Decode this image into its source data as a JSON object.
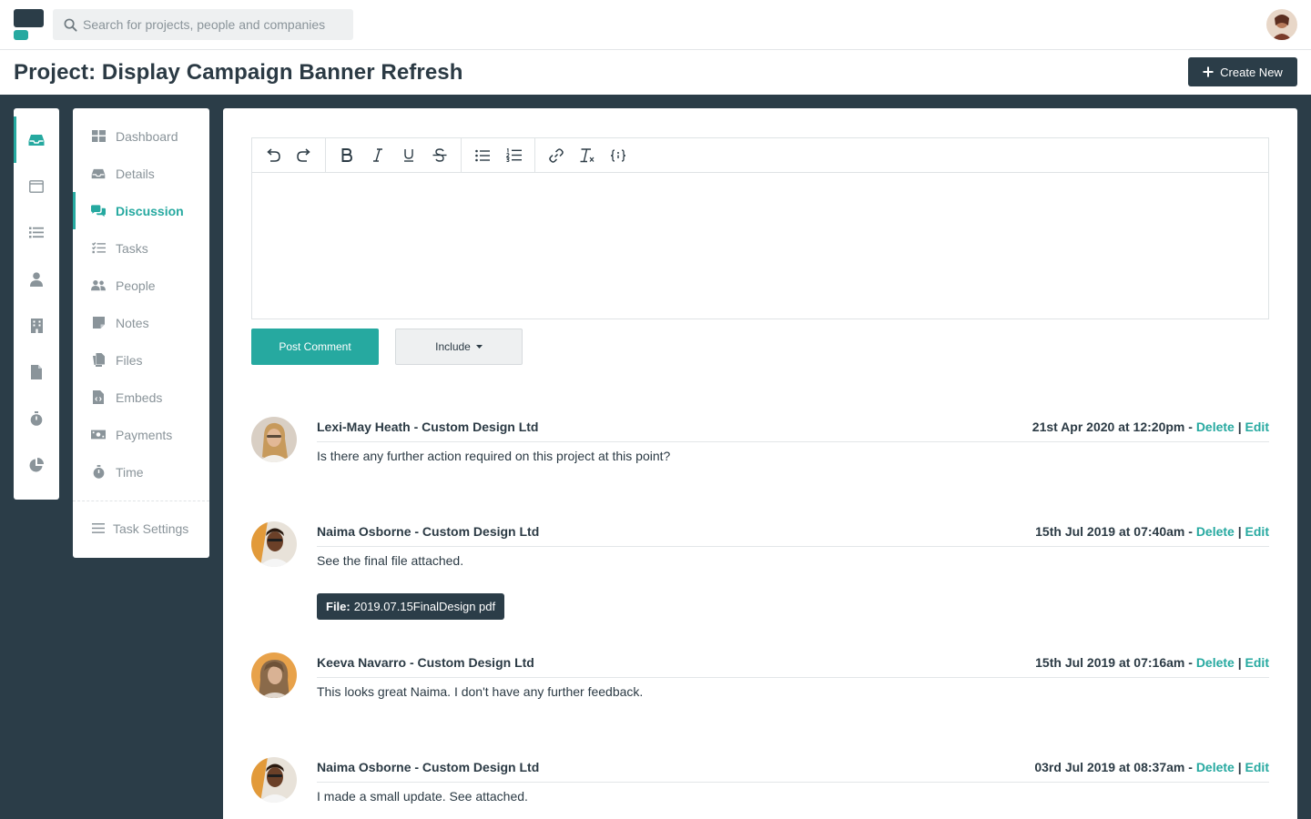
{
  "search": {
    "placeholder": "Search for projects, people and companies"
  },
  "header": {
    "title": "Project: Display Campaign Banner Refresh",
    "create_label": "Create New"
  },
  "rail": {
    "items": [
      "inbox-icon",
      "window-icon",
      "list-icon",
      "user-icon",
      "building-icon",
      "file-icon",
      "stopwatch-icon",
      "pie-chart-icon"
    ],
    "active": 0
  },
  "subnav": {
    "items": [
      {
        "label": "Dashboard",
        "icon": "grid-icon"
      },
      {
        "label": "Details",
        "icon": "inbox-icon"
      },
      {
        "label": "Discussion",
        "icon": "comments-icon",
        "active": true
      },
      {
        "label": "Tasks",
        "icon": "tasks-icon"
      },
      {
        "label": "People",
        "icon": "users-icon"
      },
      {
        "label": "Notes",
        "icon": "note-icon"
      },
      {
        "label": "Files",
        "icon": "files-icon"
      },
      {
        "label": "Embeds",
        "icon": "embed-file-icon"
      },
      {
        "label": "Payments",
        "icon": "money-icon"
      },
      {
        "label": "Time",
        "icon": "stopwatch-icon"
      }
    ],
    "settings_label": "Task Settings"
  },
  "editor": {
    "toolbar": [
      "undo-icon",
      "redo-icon",
      "bold-icon",
      "italic-icon",
      "underline-icon",
      "strikethrough-icon",
      "bullet-list-icon",
      "numbered-list-icon",
      "link-icon",
      "clear-format-icon",
      "code-icon"
    ],
    "post_label": "Post Comment",
    "include_label": "Include"
  },
  "comments": [
    {
      "author": "Lexi-May Heath - Custom Design Ltd",
      "date": "21st Apr 2020 at 12:20pm",
      "text": "Is there any further action required on this project at this point?",
      "delete_label": "Delete",
      "edit_label": "Edit"
    },
    {
      "author": "Naima Osborne - Custom Design Ltd",
      "date": "15th Jul 2019 at 07:40am",
      "text": "See the final file attached.",
      "file_prefix": "File:",
      "file_name": "2019.07.15FinalDesign pdf",
      "delete_label": "Delete",
      "edit_label": "Edit"
    },
    {
      "author": "Keeva Navarro - Custom Design Ltd",
      "date": "15th Jul 2019 at 07:16am",
      "text": "This looks great Naima. I don't have any further feedback.",
      "delete_label": "Delete",
      "edit_label": "Edit"
    },
    {
      "author": "Naima Osborne - Custom Design Ltd",
      "date": "03rd Jul 2019 at 08:37am",
      "text": "I made a small update. See attached.",
      "delete_label": "Delete",
      "edit_label": "Edit"
    }
  ],
  "colors": {
    "accent": "#26a9a0",
    "dark": "#2b3d48",
    "muted": "#8a949a"
  }
}
